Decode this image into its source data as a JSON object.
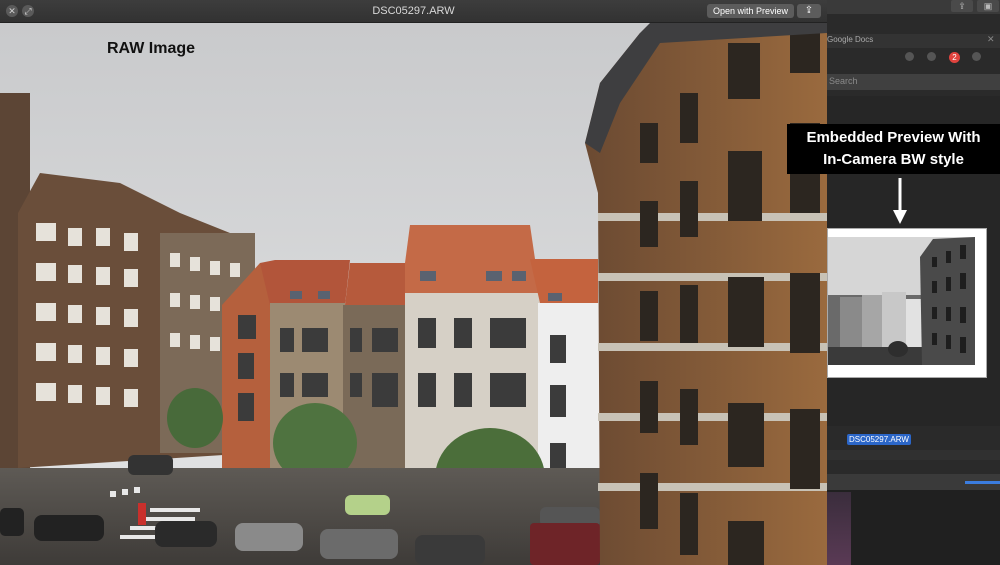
{
  "window": {
    "title": "DSC05297.ARW",
    "open_with_label": "Open with Preview",
    "close_glyph": "✕",
    "fullscreen_glyph": "⤢",
    "share_glyph": "⇪"
  },
  "photo": {
    "overlay_label": "RAW Image"
  },
  "callout": {
    "line1": "Embedded Preview With",
    "line2": "In-Camera BW style"
  },
  "background_app": {
    "tab_label": "Google Docs",
    "tab_close_glyph": "✕",
    "badge_count": "2",
    "search_placeholder": "Search",
    "selected_file": "DSC05297.ARW",
    "top_icons": [
      "share-icon",
      "sidebar-icon"
    ]
  },
  "colors": {
    "accent_blue": "#2b66c8",
    "badge_red": "#e0433e"
  }
}
